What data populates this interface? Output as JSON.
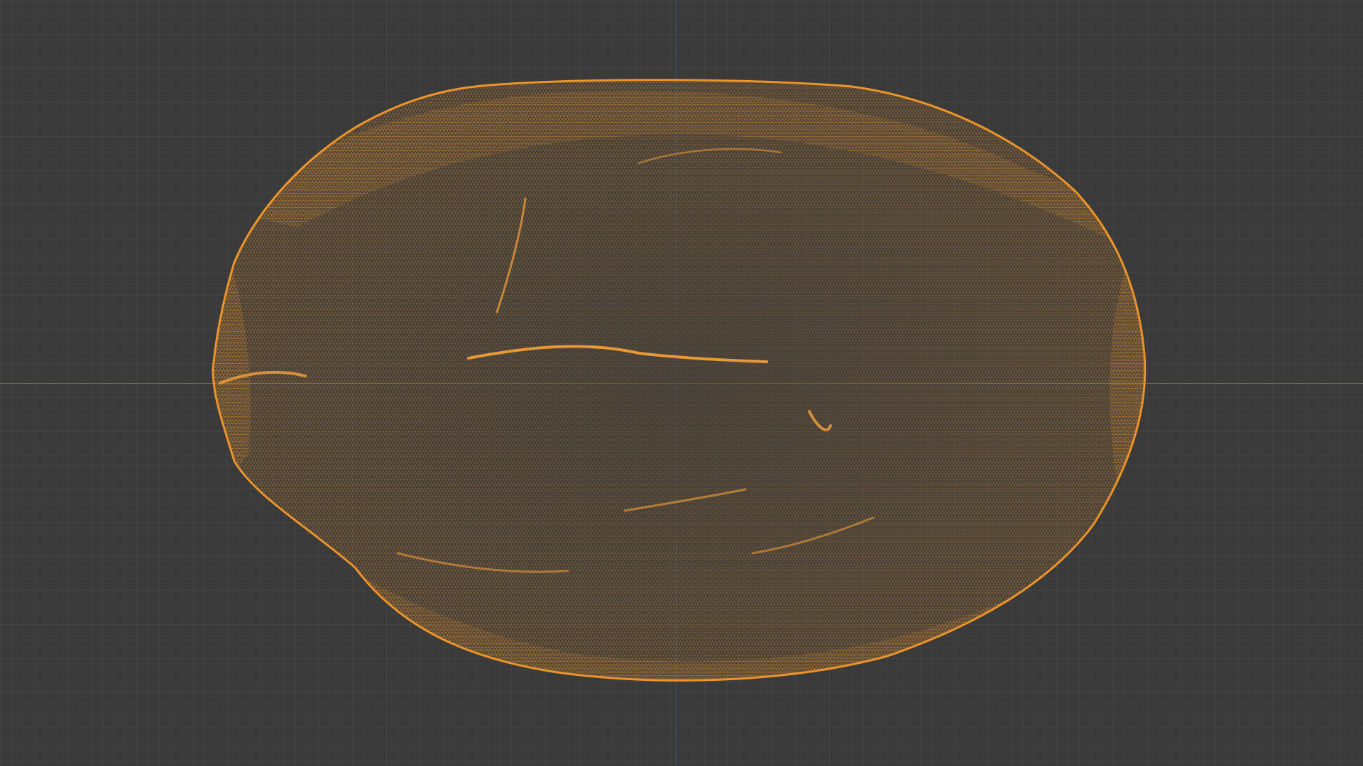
{
  "viewport": {
    "background_color": "#3a3a3a",
    "grid": true,
    "view_mode": "wireframe"
  },
  "axes": {
    "x_axis_color": "#6b7a3a",
    "y_axis_color": "#3f5a80"
  },
  "object": {
    "shape": "irregular oblong rock",
    "wire_color": "#f0962a",
    "selected": true
  }
}
